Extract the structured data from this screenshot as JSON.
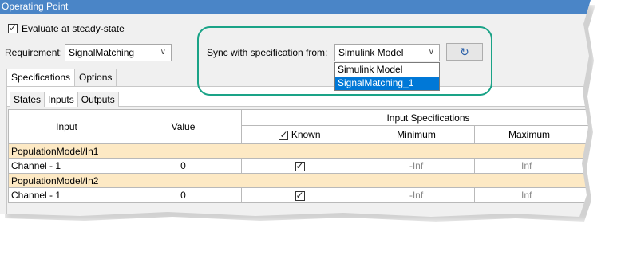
{
  "window": {
    "title": "Operating Point"
  },
  "evaluate": {
    "label": "Evaluate at steady-state",
    "checked": true
  },
  "requirement": {
    "label": "Requirement:",
    "value": "SignalMatching"
  },
  "sync": {
    "label": "Sync with specification from:",
    "value": "Simulink Model",
    "options": [
      "Simulink Model",
      "SignalMatching_1"
    ],
    "selected_option": "SignalMatching_1"
  },
  "tabs_outer": [
    "Specifications",
    "Options"
  ],
  "tabs_inner": [
    "States",
    "Inputs",
    "Outputs"
  ],
  "table": {
    "headers": {
      "input": "Input",
      "value": "Value",
      "group": "Input Specifications",
      "known": "Known",
      "minimum": "Minimum",
      "maximum": "Maximum"
    },
    "groups": [
      {
        "name": "PopulationModel/In1",
        "rows": [
          {
            "input": "Channel - 1",
            "value": "0",
            "known": true,
            "min": "-Inf",
            "max": "Inf"
          }
        ]
      },
      {
        "name": "PopulationModel/In2",
        "rows": [
          {
            "input": "Channel - 1",
            "value": "0",
            "known": true,
            "min": "-Inf",
            "max": "Inf"
          }
        ]
      }
    ]
  },
  "colors": {
    "accent": "#1aa387",
    "titlebar": "#4a85c7",
    "group_row": "#fde9c4",
    "selection": "#0078d7"
  }
}
